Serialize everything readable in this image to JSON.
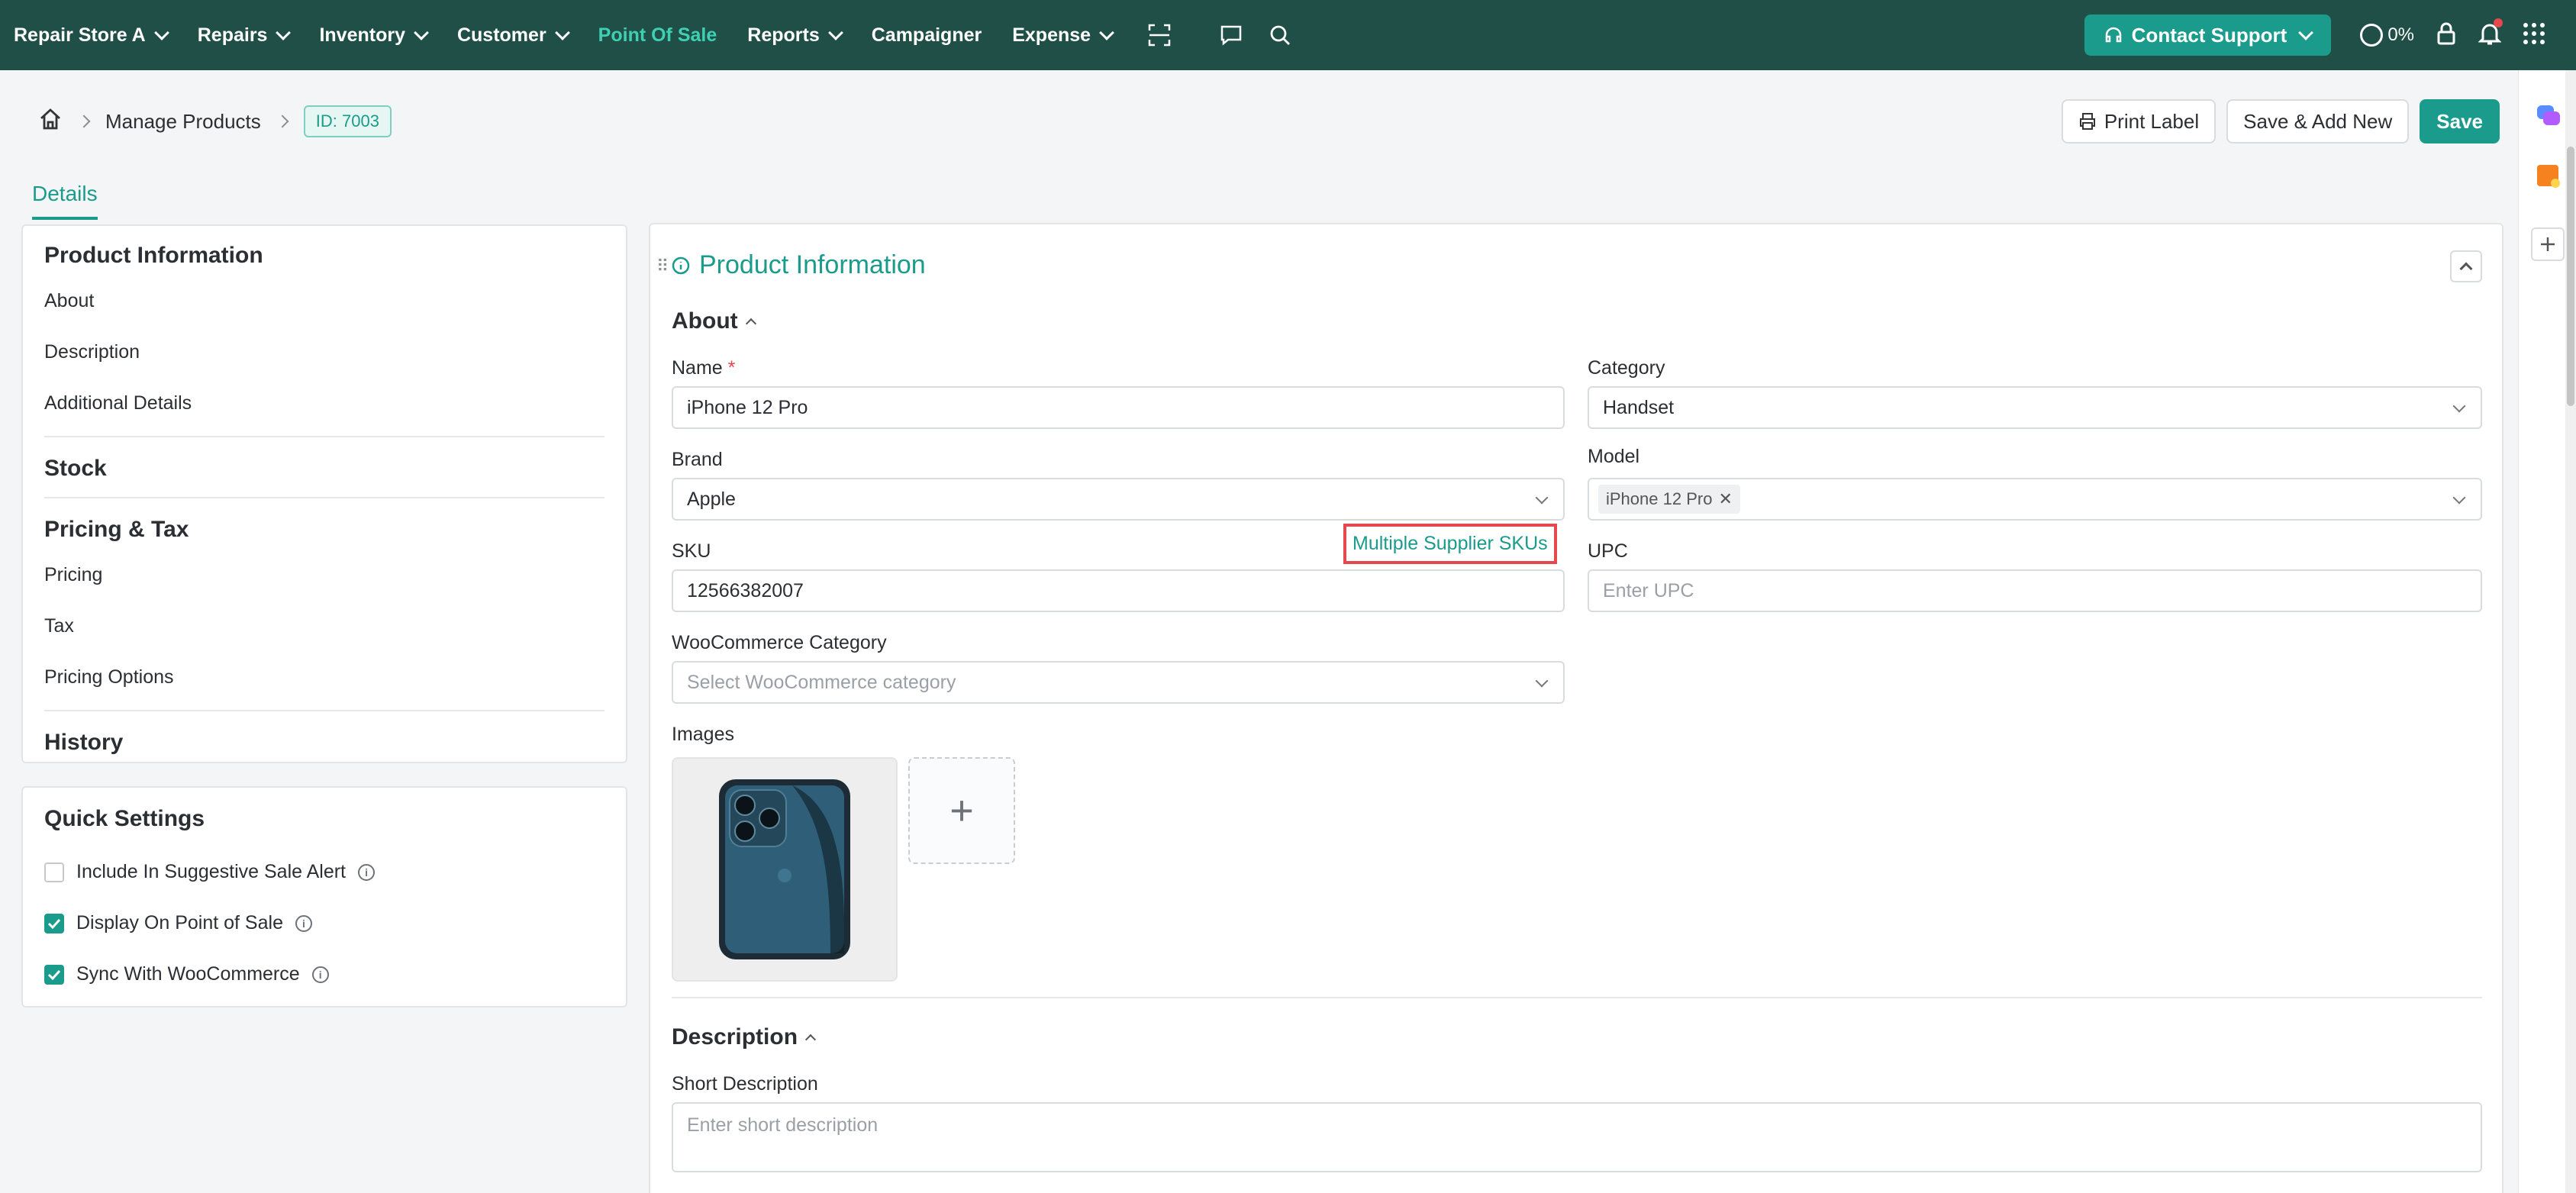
{
  "nav": {
    "items": [
      {
        "label": "Repair Store A",
        "chevron": true
      },
      {
        "label": "Repairs",
        "chevron": true
      },
      {
        "label": "Inventory",
        "chevron": true
      },
      {
        "label": "Customer",
        "chevron": true
      },
      {
        "label": "Point Of Sale",
        "chevron": false,
        "active": true
      },
      {
        "label": "Reports",
        "chevron": true
      },
      {
        "label": "Campaigner",
        "chevron": false
      },
      {
        "label": "Expense",
        "chevron": true
      }
    ],
    "support_label": "Contact Support",
    "progress_text": "0%",
    "colors": {
      "bar": "#1f4f47",
      "accent": "#1a9b8c",
      "active_text": "#3fd0b4"
    }
  },
  "breadcrumb": {
    "current": "Manage Products",
    "id_badge": "ID: 7003"
  },
  "actions": {
    "print_label": "Print Label",
    "save_add_new": "Save & Add New",
    "save": "Save"
  },
  "tabs": {
    "details": "Details"
  },
  "left_nav": {
    "product_information": "Product Information",
    "about": "About",
    "description": "Description",
    "additional_details": "Additional Details",
    "stock": "Stock",
    "pricing_tax": "Pricing & Tax",
    "pricing": "Pricing",
    "tax": "Tax",
    "pricing_options": "Pricing Options",
    "history": "History"
  },
  "quick_settings": {
    "title": "Quick Settings",
    "items": [
      {
        "label": "Include In Suggestive Sale Alert",
        "checked": false
      },
      {
        "label": "Display On Point of Sale",
        "checked": true
      },
      {
        "label": "Sync With WooCommerce",
        "checked": true
      }
    ]
  },
  "form": {
    "section_title": "Product Information",
    "about_title": "About",
    "name_label": "Name",
    "name_required": "*",
    "name_value": "iPhone 12 Pro",
    "category_label": "Category",
    "category_value": "Handset",
    "brand_label": "Brand",
    "brand_value": "Apple",
    "model_label": "Model",
    "model_tag": "iPhone 12 Pro",
    "sku_label": "SKU",
    "multiple_supplier_skus": "Multiple Supplier SKUs",
    "sku_value": "12566382007",
    "upc_label": "UPC",
    "upc_placeholder": "Enter UPC",
    "woo_category_label": "WooCommerce Category",
    "woo_category_placeholder": "Select WooCommerce category",
    "images_label": "Images",
    "description_title": "Description",
    "short_description_label": "Short Description",
    "short_description_placeholder": "Enter short description"
  }
}
